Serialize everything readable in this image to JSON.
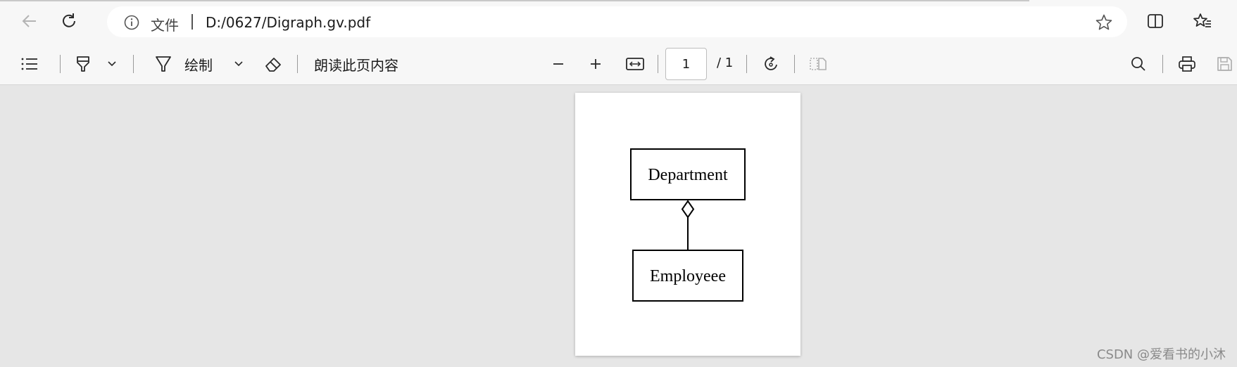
{
  "address_bar": {
    "scheme_label": "文件",
    "url": "D:/0627/Digraph.gv.pdf"
  },
  "pdf_toolbar": {
    "draw_label": "绘制",
    "read_aloud_label": "朗读此页内容",
    "page_current": "1",
    "page_total": "/ 1"
  },
  "document": {
    "nodes": [
      {
        "label": "Department"
      },
      {
        "label": "Employeee"
      }
    ],
    "edge": {
      "arrowhead": "odiamond",
      "from": "Employeee",
      "to": "Department"
    }
  },
  "watermark": "CSDN @爱看书的小沐",
  "icons": {
    "back": "back-arrow-icon",
    "refresh": "refresh-icon",
    "info": "info-icon",
    "favorite": "star-icon",
    "split": "split-screen-icon",
    "favorites": "favorites-icon",
    "contents": "contents-list-icon",
    "highlight": "highlighter-icon",
    "draw": "draw-pen-icon",
    "erase": "eraser-icon",
    "zoom_out": "minus-icon",
    "zoom_in": "plus-icon",
    "fit": "fit-width-icon",
    "rotate": "rotate-icon",
    "two_page": "page-view-icon",
    "search": "search-icon",
    "print": "print-icon",
    "save": "save-icon"
  },
  "colors": {
    "background": "#e6e6e6",
    "toolbar": "#f7f7f7",
    "page": "#ffffff"
  }
}
